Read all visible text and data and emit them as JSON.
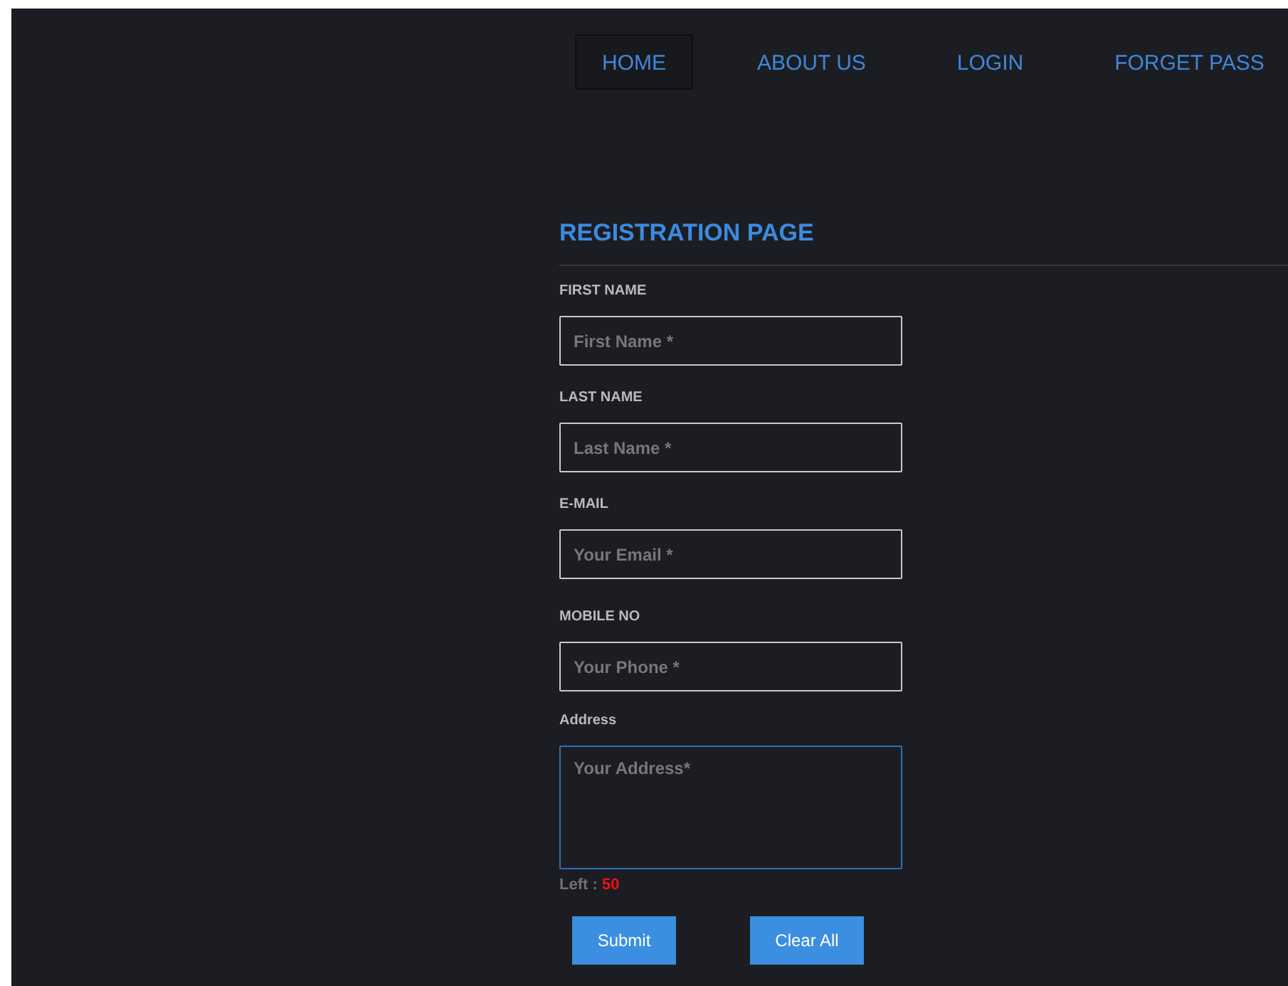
{
  "nav": [
    {
      "label": "HOME",
      "selected": true
    },
    {
      "label": "ABOUT US",
      "selected": false
    },
    {
      "label": "LOGIN",
      "selected": false
    },
    {
      "label": "FORGET PASS",
      "selected": false
    }
  ],
  "heading": "REGISTRATION PAGE",
  "fields": [
    {
      "kind": "input",
      "label": "FIRST NAME",
      "placeholder": "First Name *",
      "focused": false
    },
    {
      "kind": "input",
      "label": "LAST NAME",
      "placeholder": "Last Name *",
      "focused": false
    },
    {
      "kind": "input",
      "label": "E-MAIL",
      "placeholder": "Your Email *",
      "focused": false
    },
    {
      "kind": "input",
      "label": "MOBILE NO",
      "placeholder": "Your Phone *",
      "focused": false
    },
    {
      "kind": "textarea",
      "label": "Address",
      "placeholder": "Your Address*",
      "focused": true
    }
  ],
  "counter": {
    "label": "Left :",
    "value": "50"
  },
  "buttons": [
    "Submit",
    "Clear All"
  ]
}
